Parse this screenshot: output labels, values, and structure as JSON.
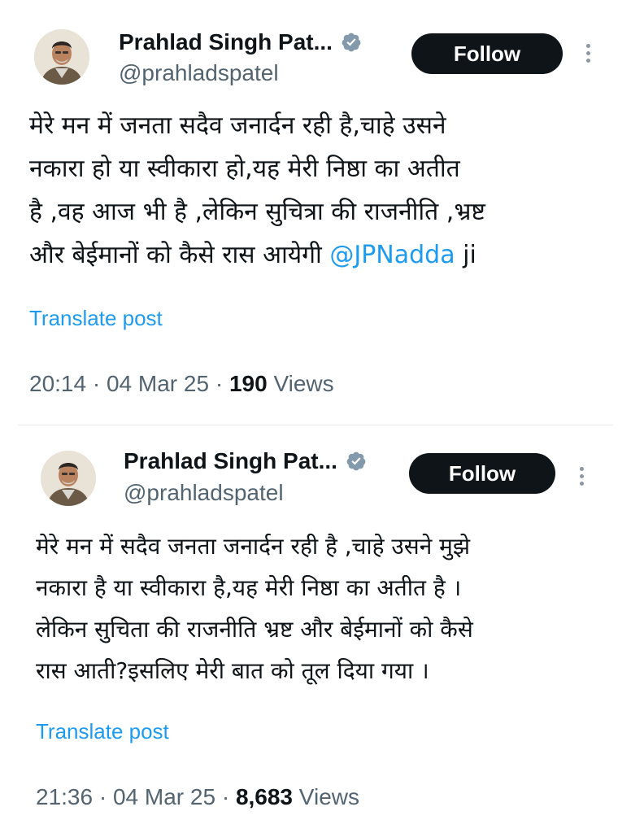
{
  "posts": [
    {
      "author_name": "Prahlad Singh Pat...",
      "handle": "@prahladspatel",
      "follow_label": "Follow",
      "text": "मेरे मन में जनता सदैव जनार्दन रही है,चाहे उसने\nनकारा हो या स्वीकारा हो,यह मेरी निष्ठा का अतीत\nहै ,वह आज भी है ,लेकिन सुचित्रा की राजनीति ,भ्रष्ट\nऔर बेईमानों को कैसे रास आयेगी ",
      "mention": "@JPNadda",
      "text_suffix": " ji",
      "translate_label": "Translate post",
      "time": "20:14",
      "date": "04 Mar 25",
      "views_count": "190",
      "views_label": "Views"
    },
    {
      "author_name": "Prahlad Singh Pat...",
      "handle": "@prahladspatel",
      "follow_label": "Follow",
      "text": "मेरे मन में सदैव जनता जनार्दन रही है ,चाहे उसने मुझे\nनकारा है या स्वीकारा है,यह मेरी निष्ठा का अतीत है ।\nलेकिन सुचिता की राजनीति भ्रष्ट और बेईमानों को कैसे\nरास आती?इसलिए मेरी बात को तूल दिया गया ।",
      "translate_label": "Translate post",
      "time": "21:36",
      "date": "04 Mar 25",
      "views_count": "8,683",
      "views_label": "Views"
    }
  ],
  "meta_separator": "·",
  "icons": {
    "verified": "verified-badge-icon",
    "more": "more-options-icon",
    "avatar": "avatar-photo"
  },
  "colors": {
    "accent": "#1d9bf0",
    "text": "#0f1419",
    "secondary": "#536471",
    "badge": "#829aab",
    "button": "#0f1419"
  }
}
